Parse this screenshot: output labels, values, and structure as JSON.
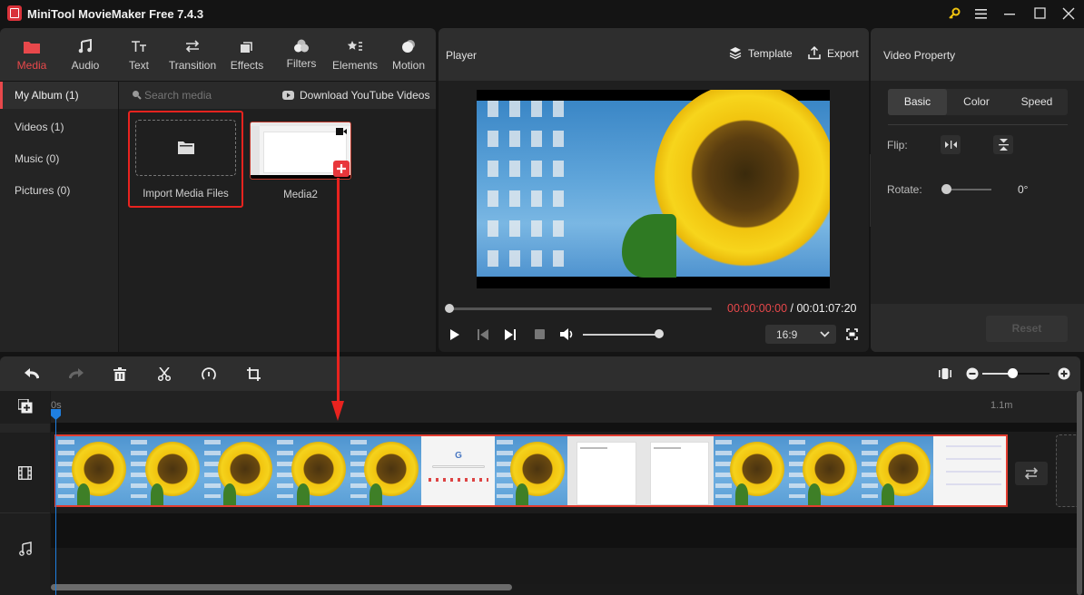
{
  "app": {
    "title": "MiniTool MovieMaker Free 7.4.3",
    "icons": {
      "logo": "app-logo",
      "license": "key-icon",
      "menu": "hamburger-icon",
      "minimize": "minimize-icon",
      "maximize": "maximize-icon",
      "close": "close-icon"
    },
    "accent_color": "#e8484b",
    "playhead_color": "#1f7fe0"
  },
  "toolbar": {
    "tabs": [
      {
        "label": "Media",
        "icon": "folder-icon",
        "active": true
      },
      {
        "label": "Audio",
        "icon": "music-note-icon",
        "active": false
      },
      {
        "label": "Text",
        "icon": "text-icon",
        "active": false
      },
      {
        "label": "Transition",
        "icon": "transition-arrows-icon",
        "active": false
      },
      {
        "label": "Effects",
        "icon": "effects-icon",
        "active": false
      },
      {
        "label": "Filters",
        "icon": "filters-icon",
        "active": false
      },
      {
        "label": "Elements",
        "icon": "elements-icon",
        "active": false
      },
      {
        "label": "Motion",
        "icon": "motion-icon",
        "active": false
      }
    ]
  },
  "sidebar": {
    "items": [
      {
        "label": "My Album (1)",
        "active": true
      },
      {
        "label": "Videos (1)",
        "active": false
      },
      {
        "label": "Music (0)",
        "active": false
      },
      {
        "label": "Pictures (0)",
        "active": false
      }
    ]
  },
  "media": {
    "search_placeholder": "Search media",
    "download_label": "Download YouTube Videos",
    "import_label": "Import Media Files",
    "items": [
      {
        "label": "Media2",
        "type": "video"
      }
    ]
  },
  "player": {
    "title": "Player",
    "template_label": "Template",
    "export_label": "Export",
    "current_time": "00:00:00:00",
    "separator": " / ",
    "total_time": "00:01:07:20",
    "progress": 0,
    "volume": 1.0,
    "aspect_ratio": "16:9"
  },
  "property": {
    "title": "Video Property",
    "tabs": [
      {
        "label": "Basic",
        "active": true
      },
      {
        "label": "Color",
        "active": false
      },
      {
        "label": "Speed",
        "active": false
      }
    ],
    "flip_label": "Flip:",
    "rotate_label": "Rotate:",
    "rotate_value": "0°",
    "reset_label": "Reset"
  },
  "timeline": {
    "ruler_start": "0s",
    "ruler_end": "1.1m",
    "zoom_level": 0.45,
    "clip_segments": [
      "sunflower",
      "sunflower",
      "sunflower",
      "sunflower",
      "sunflower",
      "google",
      "sunflower",
      "slides",
      "slides",
      "sunflower",
      "sunflower",
      "sunflower",
      "settings"
    ]
  }
}
